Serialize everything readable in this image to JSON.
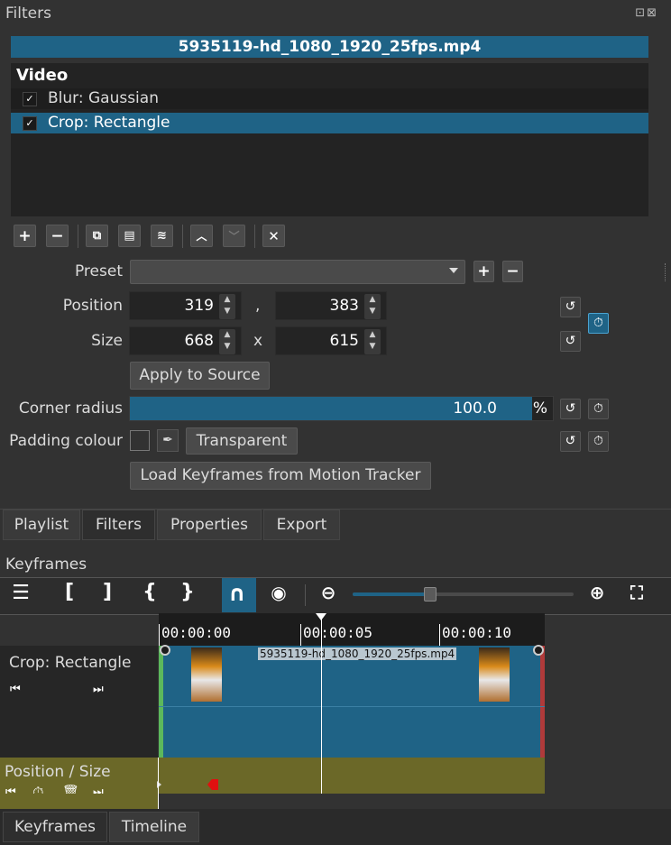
{
  "dock": {
    "title": "Filters",
    "controls": "⊡⊠"
  },
  "clip_name": "5935119-hd_1080_1920_25fps.mp4",
  "filters": {
    "section": "Video",
    "items": [
      {
        "label": "Blur: Gaussian",
        "checked": "✓"
      },
      {
        "label": "Crop: Rectangle",
        "checked": "✓"
      }
    ]
  },
  "toolbar": {
    "add": "+",
    "remove": "−",
    "copy": "⧉",
    "paste": "▤",
    "stack": "≋",
    "up": "︿",
    "down": "﹀",
    "deselect": "✕"
  },
  "form": {
    "preset_label": "Preset",
    "preset_value": "",
    "position_label": "Position",
    "position_x": "319",
    "position_sep": ",",
    "position_y": "383",
    "size_label": "Size",
    "size_w": "668",
    "size_sep": "x",
    "size_h": "615",
    "apply_to_source": "Apply to Source",
    "corner_radius_label": "Corner radius",
    "corner_radius_value": "100.0",
    "corner_radius_unit": "%",
    "corner_radius_fraction": 0.95,
    "padding_label": "Padding colour",
    "transparent_btn": "Transparent",
    "load_keyframes_btn": "Load Keyframes from Motion Tracker"
  },
  "panel_tabs": [
    "Playlist",
    "Filters",
    "Properties",
    "Export"
  ],
  "keyframes": {
    "title": "Keyframes",
    "ruler": [
      "00:00:00",
      "00:00:05",
      "00:00:10"
    ],
    "zoom_fraction": 0.35,
    "track_name": "Crop: Rectangle",
    "clip_label": "5935119-hd_1080_1920_25fps.mp4",
    "param_name": "Position / Size"
  },
  "bottom_tabs": [
    "Keyframes",
    "Timeline"
  ],
  "colors": {
    "accent": "#1f6386",
    "param_track": "#6b6828",
    "playhead": "#ffffff"
  }
}
